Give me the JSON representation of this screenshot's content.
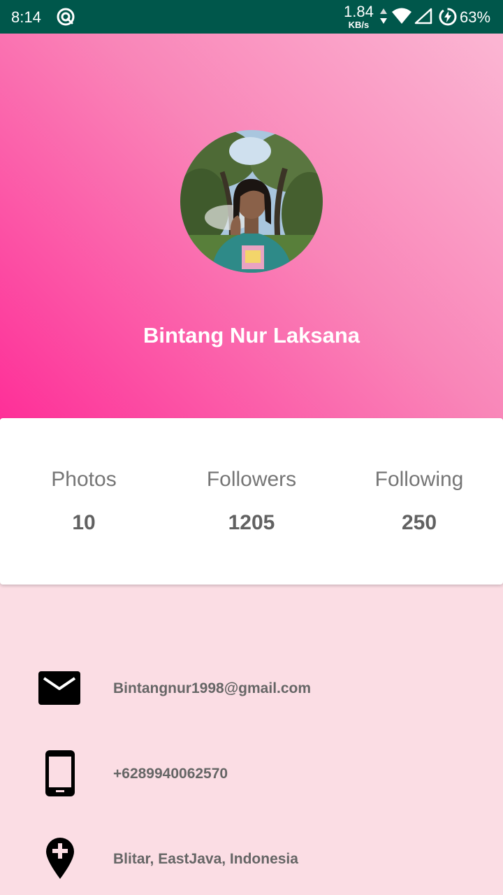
{
  "status_bar": {
    "time": "8:14",
    "net_speed": "1.84",
    "net_speed_unit": "KB/s",
    "battery_percent": "63%",
    "icons": [
      "sync-icon",
      "data-arrows-icon",
      "wifi-icon",
      "cell-signal-icon",
      "battery-saver-icon"
    ]
  },
  "profile": {
    "name": "Bintang Nur Laksana",
    "avatar": "profile-photo"
  },
  "stats": [
    {
      "label": "Photos",
      "value": "10"
    },
    {
      "label": "Followers",
      "value": "1205"
    },
    {
      "label": "Following",
      "value": "250"
    }
  ],
  "contacts": [
    {
      "icon": "email-icon",
      "value": "Bintangnur1998@gmail.com"
    },
    {
      "icon": "phone-icon",
      "value": "+6289940062570"
    },
    {
      "icon": "location-icon",
      "value": "Blitar, EastJava, Indonesia"
    }
  ],
  "colors": {
    "status_bar": "#00574b",
    "gradient_light": "#fbb6d3",
    "gradient_dark": "#fe2f98",
    "page_background": "#fbdde4",
    "card_background": "#ffffff",
    "stat_label": "#767676",
    "stat_value": "#616161",
    "contact_text": "#666666"
  }
}
